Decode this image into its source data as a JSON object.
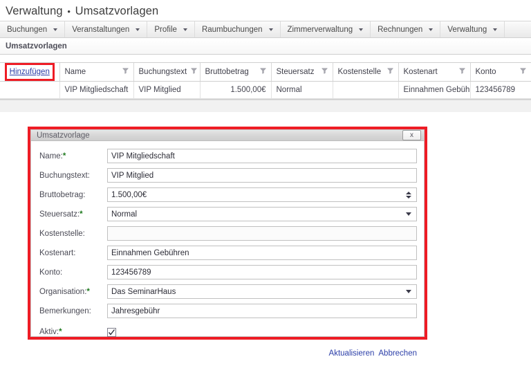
{
  "header": {
    "title_main": "Verwaltung",
    "separator": "•",
    "title_sub": "Umsatzvorlagen"
  },
  "menubar": {
    "items": [
      {
        "label": "Buchungen",
        "icon": "chevron-down-icon"
      },
      {
        "label": "Veranstaltungen",
        "icon": "chevron-down-icon"
      },
      {
        "label": "Profile",
        "icon": "chevron-down-icon"
      },
      {
        "label": "Raumbuchungen",
        "icon": "chevron-down-icon"
      },
      {
        "label": "Zimmerverwaltung",
        "icon": "chevron-down-icon"
      },
      {
        "label": "Rechnungen",
        "icon": "chevron-down-icon"
      },
      {
        "label": "Verwaltung",
        "icon": "chevron-down-icon"
      }
    ]
  },
  "section": {
    "label": "Umsatzvorlagen"
  },
  "grid": {
    "add_link": "Hinzufügen",
    "filter_icon": "filter-funnel-icon",
    "columns": [
      "Name",
      "Buchungstext",
      "Bruttobetrag",
      "Steuersatz",
      "Kostenstelle",
      "Kostenart",
      "Konto"
    ],
    "rows": [
      {
        "name": "VIP Mitgliedschaft",
        "buchungstext": "VIP Mitglied",
        "bruttobetrag": "1.500,00€",
        "steuersatz": "Normal",
        "kostenstelle": "",
        "kostenart": "Einnahmen Gebühren",
        "konto": "123456789"
      }
    ]
  },
  "dialog": {
    "title": "Umsatzvorlage",
    "close_label": "x",
    "close_icon": "close-icon",
    "fields": [
      {
        "label": "Name:",
        "required": true,
        "value": "VIP Mitgliedschaft",
        "control": "text"
      },
      {
        "label": "Buchungstext:",
        "required": false,
        "value": "VIP Mitglied",
        "control": "text"
      },
      {
        "label": "Bruttobetrag:",
        "required": false,
        "value": "1.500,00€",
        "control": "spinner"
      },
      {
        "label": "Steuersatz:",
        "required": true,
        "value": "Normal",
        "control": "select"
      },
      {
        "label": "Kostenstelle:",
        "required": false,
        "value": "",
        "control": "text"
      },
      {
        "label": "Kostenart:",
        "required": false,
        "value": "Einnahmen Gebühren",
        "control": "text"
      },
      {
        "label": "Konto:",
        "required": false,
        "value": "123456789",
        "control": "text"
      },
      {
        "label": "Organisation:",
        "required": true,
        "value": "Das SeminarHaus",
        "control": "select"
      },
      {
        "label": "Bemerkungen:",
        "required": false,
        "value": "Jahresgebühr",
        "control": "text"
      }
    ],
    "aktiv": {
      "label": "Aktiv:",
      "required": true,
      "checked": true
    },
    "actions": {
      "update": "Aktualisieren",
      "cancel": "Abbrechen"
    }
  },
  "colors": {
    "highlight": "#ee1c25",
    "link": "#2b3ea8",
    "required": "#1f7a1f"
  }
}
